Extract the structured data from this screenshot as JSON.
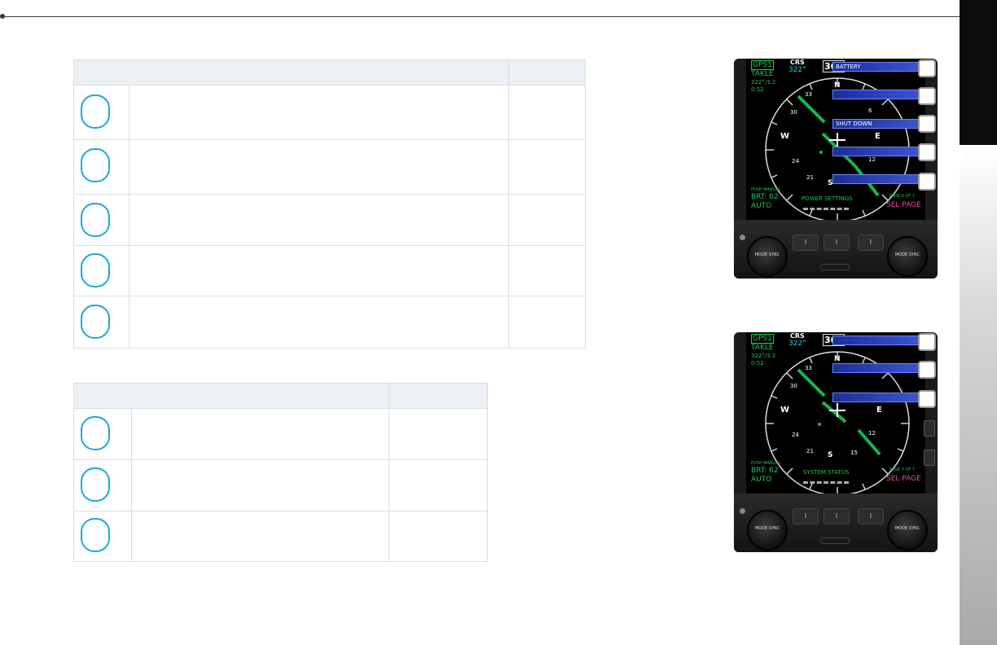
{
  "display1": {
    "source": "GPS1",
    "waypoint": "TAKLE",
    "bearing_distance": "322°/3.2",
    "time": "0:52",
    "crs_label": "CRS",
    "crs_value": "322°",
    "heading_box": "360",
    "compass_labels": [
      "N",
      "33",
      "30",
      "W",
      "24",
      "21",
      "S",
      "12",
      "E",
      "6"
    ],
    "menu_items": [
      "BATTERY",
      "",
      "SHUT DOWN",
      "",
      ""
    ],
    "push_label": "PUSH MANUAL",
    "brt_label": "BRT: 62",
    "auto_label": "AUTO",
    "page_title": "POWER SETTINGS",
    "page_indicator": "PAGE 6 OF 7",
    "sel_page": "SEL PAGE",
    "knob_left": "MODE SYNC",
    "knob_right": "MODE SYNC"
  },
  "display2": {
    "source": "GPS1",
    "waypoint": "TAKLE",
    "bearing_distance": "322°/3.2",
    "time": "0:52",
    "crs_label": "CRS",
    "crs_value": "322°",
    "heading_box": "360",
    "compass_labels": [
      "N",
      "33",
      "30",
      "W",
      "24",
      "21",
      "S",
      "15",
      "12",
      "E"
    ],
    "menu_items": [
      "",
      "",
      ""
    ],
    "push_label": "PUSH MANUAL",
    "brt_label": "BRT: 62",
    "auto_label": "AUTO",
    "page_title": "SYSTEM STATUS",
    "page_indicator": "PAGE 7 OF 7",
    "sel_page": "SEL PAGE",
    "knob_left": "MODE SYNC",
    "knob_right": "MODE SYNC"
  },
  "colors": {
    "callout_circle": "#1aa8e0",
    "green": "#19c94f",
    "cyan": "#19d3e6",
    "magenta": "#e84ea0",
    "menu_blue": "#2a44c0"
  }
}
